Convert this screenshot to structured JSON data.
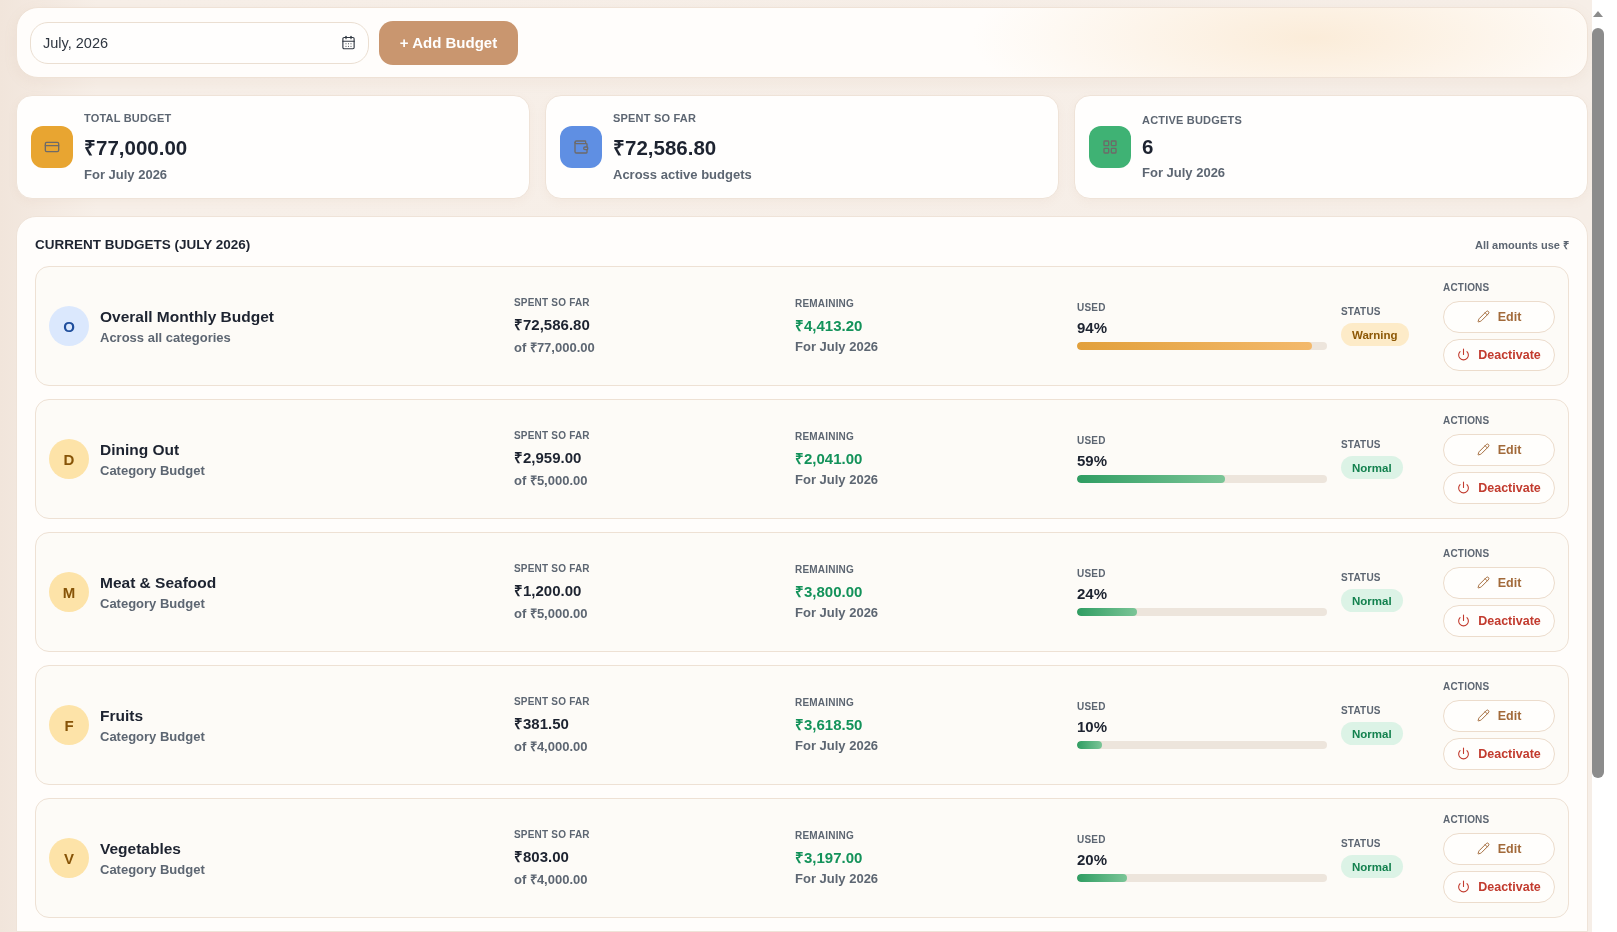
{
  "toolbar": {
    "month_field": {
      "value": "July, 2026"
    },
    "add_button": "+ Add Budget"
  },
  "summary_cards": [
    {
      "kind": "total",
      "color": "#e8a531",
      "label": "TOTAL BUDGET",
      "value": "₹77,000.00",
      "note": "For July 2026"
    },
    {
      "kind": "spent",
      "color": "#5f8fe3",
      "label": "SPENT SO FAR",
      "value": "₹72,586.80",
      "note": "Across active budgets"
    },
    {
      "kind": "active",
      "color": "#3fb274",
      "label": "ACTIVE BUDGETS",
      "value": "6",
      "note": "For July 2026"
    }
  ],
  "budgets_panel": {
    "title": "CURRENT BUDGETS (JULY 2026)",
    "note": "All amounts use ₹",
    "rows": [
      {
        "kind": "overall",
        "initial": "O",
        "name": "Overall Monthly Budget",
        "subtitle": "Across all categories",
        "spent_label": "SPENT SO FAR",
        "spent": "₹72,586.80",
        "spent_of": "of ₹77,000.00",
        "remaining_label": "REMAINING",
        "remaining": "₹4,413.20",
        "remaining_note": "For July 2026",
        "used_label": "USED",
        "used": "94%",
        "level": 0.94,
        "status_label": "STATUS",
        "status": {
          "kind": "warning",
          "text": "Warning"
        },
        "actions_label": "ACTIONS",
        "actions": [
          {
            "kind": "edit",
            "label": "Edit"
          },
          {
            "kind": "deactivate",
            "label": "Deactivate"
          }
        ]
      },
      {
        "kind": "category",
        "initial": "D",
        "name": "Dining Out",
        "subtitle": "Category Budget",
        "spent_label": "SPENT SO FAR",
        "spent": "₹2,959.00",
        "spent_of": "of ₹5,000.00",
        "remaining_label": "REMAINING",
        "remaining": "₹2,041.00",
        "remaining_note": "For July 2026",
        "used_label": "USED",
        "used": "59%",
        "level": 0.59,
        "status_label": "STATUS",
        "status": {
          "kind": "normal",
          "text": "Normal"
        },
        "actions_label": "ACTIONS",
        "actions": [
          {
            "kind": "edit",
            "label": "Edit"
          },
          {
            "kind": "deactivate",
            "label": "Deactivate"
          }
        ]
      },
      {
        "kind": "category",
        "initial": "M",
        "name": "Meat & Seafood",
        "subtitle": "Category Budget",
        "spent_label": "SPENT SO FAR",
        "spent": "₹1,200.00",
        "spent_of": "of ₹5,000.00",
        "remaining_label": "REMAINING",
        "remaining": "₹3,800.00",
        "remaining_note": "For July 2026",
        "used_label": "USED",
        "used": "24%",
        "level": 0.24,
        "status_label": "STATUS",
        "status": {
          "kind": "normal",
          "text": "Normal"
        },
        "actions_label": "ACTIONS",
        "actions": [
          {
            "kind": "edit",
            "label": "Edit"
          },
          {
            "kind": "deactivate",
            "label": "Deactivate"
          }
        ]
      },
      {
        "kind": "category",
        "initial": "F",
        "name": "Fruits",
        "subtitle": "Category Budget",
        "spent_label": "SPENT SO FAR",
        "spent": "₹381.50",
        "spent_of": "of ₹4,000.00",
        "remaining_label": "REMAINING",
        "remaining": "₹3,618.50",
        "remaining_note": "For July 2026",
        "used_label": "USED",
        "used": "10%",
        "level": 0.1,
        "status_label": "STATUS",
        "status": {
          "kind": "normal",
          "text": "Normal"
        },
        "actions_label": "ACTIONS",
        "actions": [
          {
            "kind": "edit",
            "label": "Edit"
          },
          {
            "kind": "deactivate",
            "label": "Deactivate"
          }
        ]
      },
      {
        "kind": "category",
        "initial": "V",
        "name": "Vegetables",
        "subtitle": "Category Budget",
        "spent_label": "SPENT SO FAR",
        "spent": "₹803.00",
        "spent_of": "of ₹4,000.00",
        "remaining_label": "REMAINING",
        "remaining": "₹3,197.00",
        "remaining_note": "For July 2026",
        "used_label": "USED",
        "used": "20%",
        "level": 0.2,
        "status_label": "STATUS",
        "status": {
          "kind": "normal",
          "text": "Normal"
        },
        "actions_label": "ACTIONS",
        "actions": [
          {
            "kind": "edit",
            "label": "Edit"
          },
          {
            "kind": "deactivate",
            "label": "Deactivate"
          }
        ]
      }
    ]
  }
}
